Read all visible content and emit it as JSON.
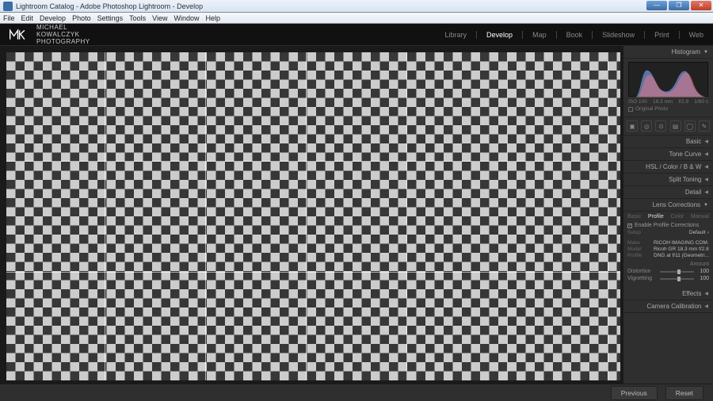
{
  "window": {
    "title": "Lightroom Catalog - Adobe Photoshop Lightroom - Develop"
  },
  "menu": [
    "File",
    "Edit",
    "Develop",
    "Photo",
    "Settings",
    "Tools",
    "View",
    "Window",
    "Help"
  ],
  "logo": {
    "line1": "MICHAEL",
    "line2": "KOWALCZYK",
    "line3": "PHOTOGRAPHY"
  },
  "modules": {
    "items": [
      "Library",
      "Develop",
      "Map",
      "Book",
      "Slideshow",
      "Print",
      "Web"
    ],
    "active": "Develop"
  },
  "panel": {
    "histogram_label": "Histogram",
    "histogram_info": {
      "a": "ISO 100",
      "b": "18.3 mm",
      "c": "f/2.8",
      "d": "1/60 s"
    },
    "original_photo": "Original Photo",
    "basic": "Basic",
    "tone_curve": "Tone Curve",
    "hsl": "HSL / Color / B & W",
    "split": "Split Toning",
    "detail": "Detail",
    "lens": "Lens Corrections",
    "lens_tabs": [
      "Basic",
      "Profile",
      "Color",
      "Manual"
    ],
    "enable_profile": "Enable Profile Corrections",
    "setup_label": "Setup",
    "setup_value": "Default",
    "make_label": "Make",
    "make_value": "RICOH IMAGING COM…",
    "model_label": "Model",
    "model_value": "Ricoh GR 18.3 mm f/2.8",
    "profile_label": "Profile",
    "profile_value": "DNG at f/11 (Geometri…",
    "amount_label": "Amount",
    "dist_label": "Distortion",
    "dist_val": "100",
    "vig_label": "Vignetting",
    "vig_val": "100",
    "effects": "Effects",
    "calib": "Camera Calibration"
  },
  "bottom": {
    "previous": "Previous",
    "reset": "Reset"
  }
}
